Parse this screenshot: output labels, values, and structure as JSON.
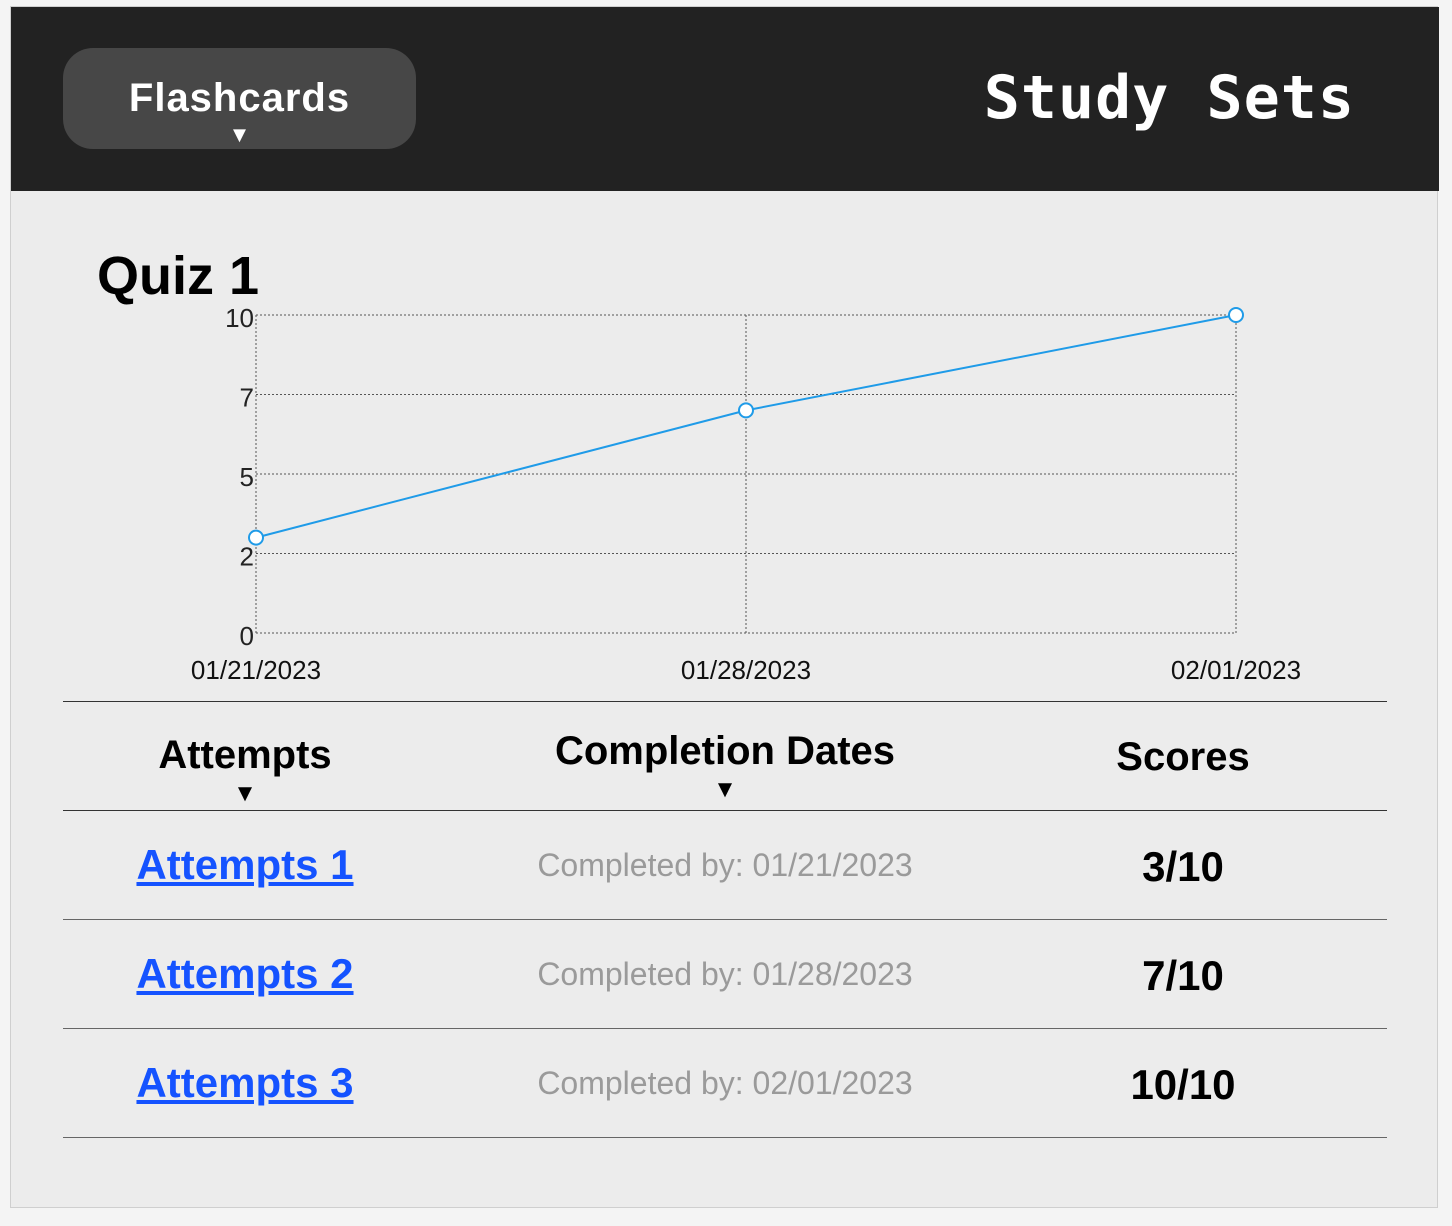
{
  "header": {
    "menu_label": "Flashcards",
    "menu_caret": "▼",
    "app_title": "Study Sets"
  },
  "quiz": {
    "title": "Quiz 1"
  },
  "chart_data": {
    "type": "line",
    "x": [
      "01/21/2023",
      "01/28/2023",
      "02/01/2023"
    ],
    "series": [
      {
        "values": [
          3,
          7,
          10
        ],
        "color": "#1f9be8"
      }
    ],
    "ylim": [
      0,
      10
    ],
    "yticks": [
      0,
      2,
      5,
      7,
      10
    ],
    "grid": true
  },
  "table": {
    "headers": [
      {
        "label": "Attempts",
        "caret": "▼"
      },
      {
        "label": "Completion Dates",
        "caret": "▼"
      },
      {
        "label": "Scores",
        "caret": ""
      }
    ],
    "rows": [
      {
        "attempt": "Attempts 1",
        "date": "Completed by: 01/21/2023",
        "score": "3/10"
      },
      {
        "attempt": "Attempts 2",
        "date": "Completed by: 01/28/2023",
        "score": "7/10"
      },
      {
        "attempt": "Attempts 3",
        "date": "Completed by: 02/01/2023",
        "score": "10/10"
      }
    ]
  },
  "colors": {
    "link": "#1553ff",
    "topbar": "#222222",
    "line": "#1f9be8"
  }
}
